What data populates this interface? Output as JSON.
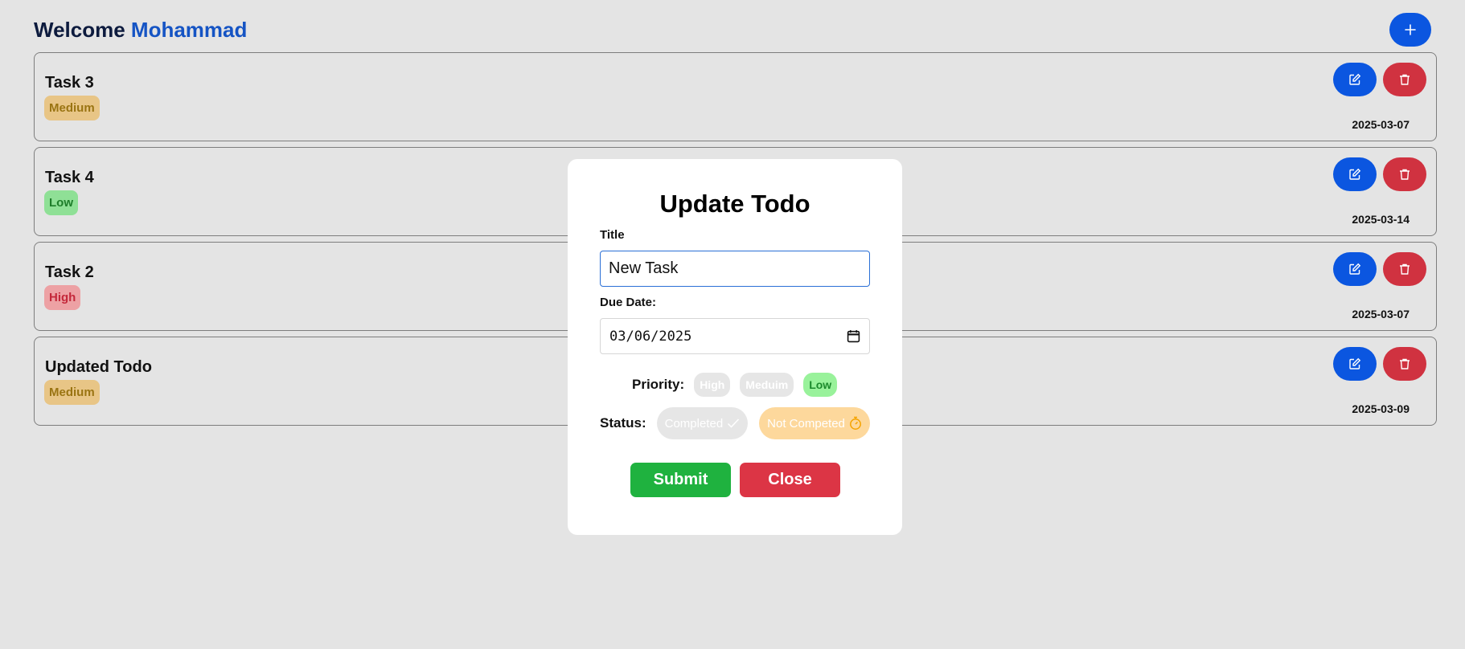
{
  "header": {
    "welcome": "Welcome",
    "user_name": "Mohammad",
    "add_icon": "plus-icon"
  },
  "tasks": [
    {
      "title": "Task 3",
      "priority": "Medium",
      "date": "2025-03-07"
    },
    {
      "title": "Task 4",
      "priority": "Low",
      "date": "2025-03-14"
    },
    {
      "title": "Task 2",
      "priority": "High",
      "date": "2025-03-07"
    },
    {
      "title": "Updated Todo",
      "priority": "Medium",
      "date": "2025-03-09"
    }
  ],
  "icons": {
    "edit": "edit-icon",
    "delete": "trash-icon",
    "calendar": "calendar-icon"
  },
  "modal": {
    "title": "Update Todo",
    "title_label": "Title",
    "title_value": "New Task",
    "due_label": "Due Date:",
    "due_value": "03/06/2025",
    "priority_label": "Priority:",
    "priority_options": [
      "High",
      "Meduim",
      "Low"
    ],
    "priority_selected": "Low",
    "status_label": "Status:",
    "status_completed": "Completed",
    "status_not_completed": "Not Competed",
    "status_selected": "Not Competed",
    "submit_label": "Submit",
    "close_label": "Close"
  },
  "colors": {
    "background": "#e4e4e4",
    "primary": "#0b56e0",
    "danger": "#d03240",
    "success": "#1fb23f",
    "medium_badge": "#e8c586",
    "low_badge": "#8fe096",
    "high_badge": "#eda1a4"
  }
}
